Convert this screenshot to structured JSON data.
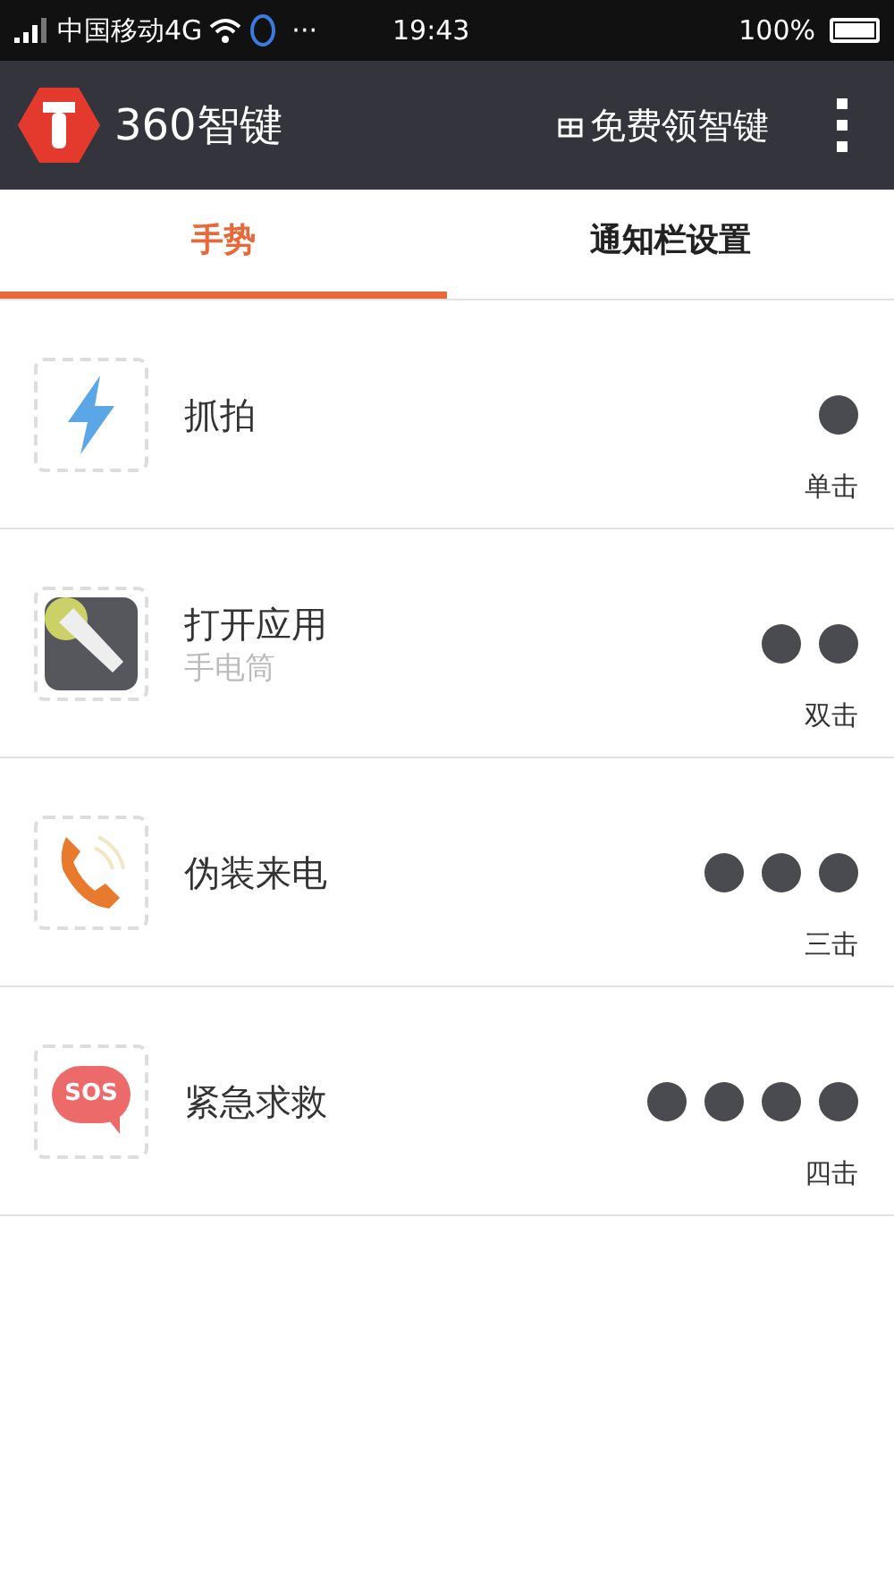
{
  "status_bar": {
    "carrier": "中国移动4G",
    "more": "···",
    "time": "19:43",
    "battery": "100%"
  },
  "app_bar": {
    "title": "360智键",
    "promo": "免费领智键"
  },
  "tabs": [
    {
      "label": "手势",
      "selected": true
    },
    {
      "label": "通知栏设置",
      "selected": false
    }
  ],
  "gestures": [
    {
      "title": "抓拍",
      "kind": "single",
      "tap_label": "单击"
    },
    {
      "title": "打开应用",
      "subtitle": "手电筒",
      "kind": "double",
      "tap_label": "双击"
    },
    {
      "title": "伪装来电",
      "kind": "triple",
      "tap_label": "三击"
    },
    {
      "title": "紧急求救",
      "kind": "quadruple",
      "tap_label": "四击",
      "icon_text": "SOS"
    }
  ]
}
